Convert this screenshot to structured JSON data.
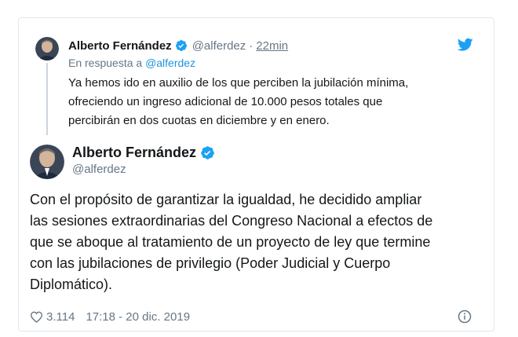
{
  "colors": {
    "accent": "#1da1f2",
    "link": "#1b95e0",
    "muted": "#657786",
    "text": "#14171a",
    "border": "#e1e8ed"
  },
  "parent_tweet": {
    "author_name": "Alberto Fernández",
    "handle": "@alferdez",
    "separator": "·",
    "time": "22min",
    "reply_prefix": "En respuesta a",
    "reply_handle": "@alferdez",
    "text_lines": [
      "Ya hemos ido en auxilio de los que perciben la jubilación mínima,",
      "ofreciendo un ingreso adicional de 10.000 pesos totales que",
      "percibirán en dos cuotas en diciembre y en enero."
    ],
    "icons": [
      "verified-icon",
      "twitter-bird-icon"
    ]
  },
  "main_tweet": {
    "author_name": "Alberto Fernández",
    "handle": "@alferdez",
    "text_lines": [
      "Con el propósito de garantizar la igualdad, he decidido ampliar",
      "las sesiones extraordinarias del Congreso Nacional a efectos de",
      "que se aboque al tratamiento de un proyecto de ley que termine",
      "con las jubilaciones de privilegio (Poder Judicial y Cuerpo",
      "Diplomático)."
    ],
    "likes": "3.114",
    "timestamp": "17:18 - 20 dic. 2019",
    "icons": [
      "verified-icon",
      "heart-icon",
      "info-icon"
    ]
  }
}
